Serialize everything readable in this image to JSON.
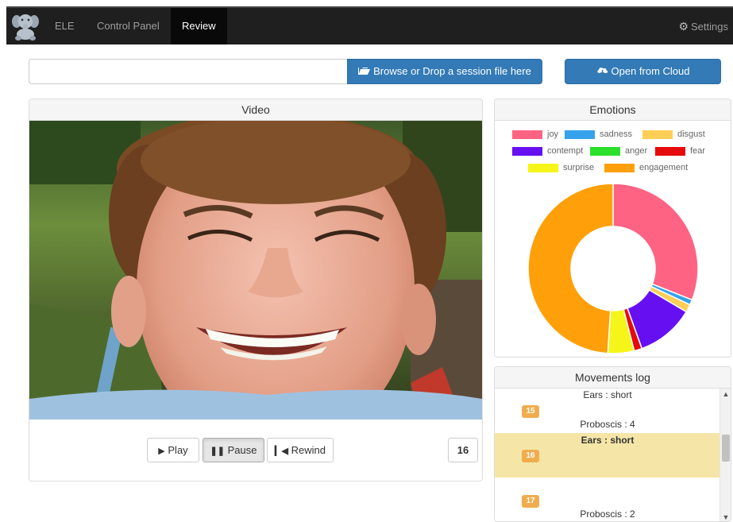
{
  "navbar": {
    "logo_icon": "elephant-logo-icon",
    "items": [
      {
        "label": "ELE"
      },
      {
        "label": "Control Panel"
      },
      {
        "label": "Review",
        "active": true
      }
    ],
    "settings_label": "Settings",
    "settings_icon": "gear-icon"
  },
  "file_bar": {
    "input_value": "",
    "browse_label": "Browse or Drop a session file here",
    "browse_icon": "folder-open-icon",
    "cloud_label": "Open from Cloud",
    "cloud_icon": "cloud-download-icon"
  },
  "video": {
    "title": "Video",
    "controls": {
      "play_label": "Play",
      "pause_label": "Pause",
      "rewind_label": "Rewind",
      "active": "pause"
    },
    "frame": "16"
  },
  "emotions": {
    "title": "Emotions",
    "legend": [
      {
        "name": "joy",
        "color": "#ff6384"
      },
      {
        "name": "sadness",
        "color": "#36a2eb"
      },
      {
        "name": "disgust",
        "color": "#ffce56"
      },
      {
        "name": "contempt",
        "color": "#6610f2"
      },
      {
        "name": "anger",
        "color": "#2ce02c"
      },
      {
        "name": "fear",
        "color": "#e60b0b"
      },
      {
        "name": "surprise",
        "color": "#f5f51a"
      },
      {
        "name": "engagement",
        "color": "#ffa00a"
      }
    ],
    "chart_data": {
      "type": "pie",
      "categories": [
        "joy",
        "sadness",
        "disgust",
        "contempt",
        "anger",
        "fear",
        "surprise",
        "engagement"
      ],
      "values": [
        31,
        1,
        1.5,
        11,
        0,
        1.5,
        5,
        49
      ],
      "legend": "top"
    }
  },
  "movements": {
    "title": "Movements log",
    "entries": [
      {
        "id": "15",
        "top_text": "Ears : short",
        "bottom_text": "Proboscis : 4",
        "highlight": false
      },
      {
        "id": "16",
        "top_text": "Ears : short",
        "bottom_text": "",
        "highlight": true
      },
      {
        "id": "17",
        "top_text": "",
        "bottom_text": "Proboscis : 2",
        "highlight": false
      }
    ]
  }
}
